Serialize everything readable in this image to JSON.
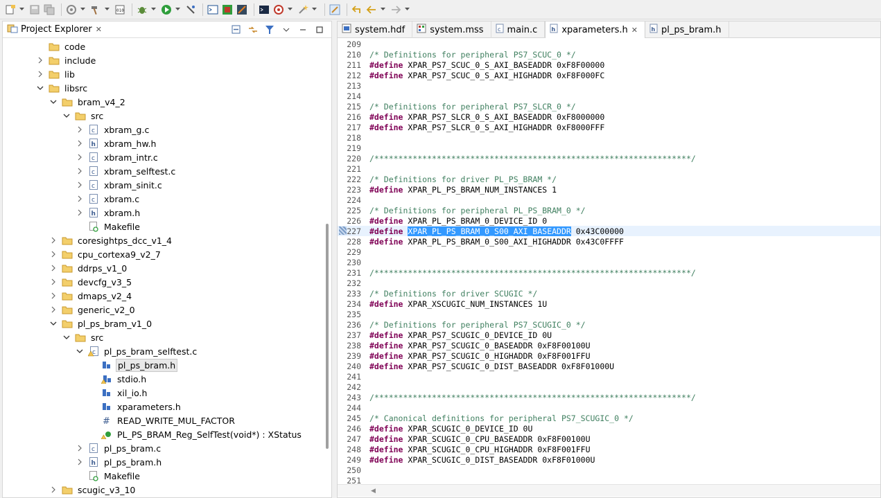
{
  "toolbar": {
    "icons": [
      "new-icon",
      "save-icon",
      "save-all-icon",
      "build-config-icon",
      "hammer-icon",
      "binary-icon",
      "debug-icon",
      "run-icon",
      "program-fpga-icon",
      "terminal-icon",
      "xsct-icon",
      "jtag-icon",
      "console-icon",
      "target-icon",
      "wand-icon",
      "edit-icon",
      "back-edit-icon",
      "back-icon",
      "forward-icon"
    ]
  },
  "explorer": {
    "title": "Project Explorer",
    "close": "✕",
    "tree": [
      {
        "label": "code",
        "indent": 0,
        "twisty": "none",
        "icon": "folder"
      },
      {
        "label": "include",
        "indent": 0,
        "twisty": "closed",
        "icon": "folder"
      },
      {
        "label": "lib",
        "indent": 0,
        "twisty": "closed",
        "icon": "folder"
      },
      {
        "label": "libsrc",
        "indent": 0,
        "twisty": "open",
        "icon": "folder"
      },
      {
        "label": "bram_v4_2",
        "indent": 1,
        "twisty": "open",
        "icon": "folder"
      },
      {
        "label": "src",
        "indent": 2,
        "twisty": "open",
        "icon": "folder"
      },
      {
        "label": "xbram_g.c",
        "indent": 3,
        "twisty": "closed",
        "icon": "c"
      },
      {
        "label": "xbram_hw.h",
        "indent": 3,
        "twisty": "closed",
        "icon": "h"
      },
      {
        "label": "xbram_intr.c",
        "indent": 3,
        "twisty": "closed",
        "icon": "c"
      },
      {
        "label": "xbram_selftest.c",
        "indent": 3,
        "twisty": "closed",
        "icon": "c"
      },
      {
        "label": "xbram_sinit.c",
        "indent": 3,
        "twisty": "closed",
        "icon": "c"
      },
      {
        "label": "xbram.c",
        "indent": 3,
        "twisty": "closed",
        "icon": "c"
      },
      {
        "label": "xbram.h",
        "indent": 3,
        "twisty": "closed",
        "icon": "h"
      },
      {
        "label": "Makefile",
        "indent": 3,
        "twisty": "none",
        "icon": "make"
      },
      {
        "label": "coresightps_dcc_v1_4",
        "indent": 1,
        "twisty": "closed",
        "icon": "folder"
      },
      {
        "label": "cpu_cortexa9_v2_7",
        "indent": 1,
        "twisty": "closed",
        "icon": "folder"
      },
      {
        "label": "ddrps_v1_0",
        "indent": 1,
        "twisty": "closed",
        "icon": "folder"
      },
      {
        "label": "devcfg_v3_5",
        "indent": 1,
        "twisty": "closed",
        "icon": "folder"
      },
      {
        "label": "dmaps_v2_4",
        "indent": 1,
        "twisty": "closed",
        "icon": "folder"
      },
      {
        "label": "generic_v2_0",
        "indent": 1,
        "twisty": "closed",
        "icon": "folder"
      },
      {
        "label": "pl_ps_bram_v1_0",
        "indent": 1,
        "twisty": "open",
        "icon": "folder"
      },
      {
        "label": "src",
        "indent": 2,
        "twisty": "open",
        "icon": "folder"
      },
      {
        "label": "pl_ps_bram_selftest.c",
        "indent": 3,
        "twisty": "open",
        "icon": "c-warn"
      },
      {
        "label": "pl_ps_bram.h",
        "indent": 4,
        "twisty": "none",
        "icon": "include",
        "selected": true
      },
      {
        "label": "stdio.h",
        "indent": 4,
        "twisty": "none",
        "icon": "include-warn"
      },
      {
        "label": "xil_io.h",
        "indent": 4,
        "twisty": "none",
        "icon": "include"
      },
      {
        "label": "xparameters.h",
        "indent": 4,
        "twisty": "none",
        "icon": "include"
      },
      {
        "label": "READ_WRITE_MUL_FACTOR",
        "indent": 4,
        "twisty": "none",
        "icon": "macro"
      },
      {
        "label": "PL_PS_BRAM_Reg_SelfTest(void*) : XStatus",
        "indent": 4,
        "twisty": "none",
        "icon": "function"
      },
      {
        "label": "pl_ps_bram.c",
        "indent": 3,
        "twisty": "closed",
        "icon": "c"
      },
      {
        "label": "pl_ps_bram.h",
        "indent": 3,
        "twisty": "closed",
        "icon": "h"
      },
      {
        "label": "Makefile",
        "indent": 3,
        "twisty": "none",
        "icon": "make"
      },
      {
        "label": "scugic_v3_10",
        "indent": 1,
        "twisty": "closed",
        "icon": "folder"
      }
    ]
  },
  "editor": {
    "tabs": [
      {
        "label": "system.hdf",
        "icon": "hdf",
        "active": false
      },
      {
        "label": "system.mss",
        "icon": "mss",
        "active": false
      },
      {
        "label": "main.c",
        "icon": "c",
        "active": false
      },
      {
        "label": "xparameters.h",
        "icon": "h",
        "active": true,
        "close": "✕"
      },
      {
        "label": "pl_ps_bram.h",
        "icon": "h",
        "active": false
      }
    ],
    "lines": [
      {
        "n": "209",
        "type": "blank",
        "text": ""
      },
      {
        "n": "210",
        "type": "comment",
        "text": "/* Definitions for peripheral PS7_SCUC_0 */"
      },
      {
        "n": "211",
        "type": "define",
        "kw": "#define",
        "text": " XPAR_PS7_SCUC_0_S_AXI_BASEADDR 0xF8F00000"
      },
      {
        "n": "212",
        "type": "define",
        "kw": "#define",
        "text": " XPAR_PS7_SCUC_0_S_AXI_HIGHADDR 0xF8F000FC"
      },
      {
        "n": "213",
        "type": "blank",
        "text": ""
      },
      {
        "n": "214",
        "type": "blank",
        "text": ""
      },
      {
        "n": "215",
        "type": "comment",
        "text": "/* Definitions for peripheral PS7_SLCR_0 */"
      },
      {
        "n": "216",
        "type": "define",
        "kw": "#define",
        "text": " XPAR_PS7_SLCR_0_S_AXI_BASEADDR 0xF8000000"
      },
      {
        "n": "217",
        "type": "define",
        "kw": "#define",
        "text": " XPAR_PS7_SLCR_0_S_AXI_HIGHADDR 0xF8000FFF"
      },
      {
        "n": "218",
        "type": "blank",
        "text": ""
      },
      {
        "n": "219",
        "type": "blank",
        "text": ""
      },
      {
        "n": "220",
        "type": "comment",
        "text": "/******************************************************************/"
      },
      {
        "n": "221",
        "type": "blank",
        "text": ""
      },
      {
        "n": "222",
        "type": "comment",
        "text": "/* Definitions for driver PL_PS_BRAM */"
      },
      {
        "n": "223",
        "type": "define",
        "kw": "#define",
        "text": " XPAR_PL_PS_BRAM_NUM_INSTANCES 1"
      },
      {
        "n": "224",
        "type": "blank",
        "text": ""
      },
      {
        "n": "225",
        "type": "comment",
        "text": "/* Definitions for peripheral PL_PS_BRAM_0 */"
      },
      {
        "n": "226",
        "type": "define",
        "kw": "#define",
        "text": " XPAR_PL_PS_BRAM_0_DEVICE_ID 0"
      },
      {
        "n": "227",
        "type": "define-hl",
        "kw": "#define",
        "hl": "XPAR_PL_PS_BRAM_0_S00_AXI_BASEADDR",
        "text": " 0x43C00000",
        "current": true
      },
      {
        "n": "228",
        "type": "define",
        "kw": "#define",
        "text": " XPAR_PL_PS_BRAM_0_S00_AXI_HIGHADDR 0x43C0FFFF"
      },
      {
        "n": "229",
        "type": "blank",
        "text": ""
      },
      {
        "n": "230",
        "type": "blank",
        "text": ""
      },
      {
        "n": "231",
        "type": "comment",
        "text": "/******************************************************************/"
      },
      {
        "n": "232",
        "type": "blank",
        "text": ""
      },
      {
        "n": "233",
        "type": "comment",
        "text": "/* Definitions for driver SCUGIC */"
      },
      {
        "n": "234",
        "type": "define",
        "kw": "#define",
        "text": " XPAR_XSCUGIC_NUM_INSTANCES 1U"
      },
      {
        "n": "235",
        "type": "blank",
        "text": ""
      },
      {
        "n": "236",
        "type": "comment",
        "text": "/* Definitions for peripheral PS7_SCUGIC_0 */"
      },
      {
        "n": "237",
        "type": "define",
        "kw": "#define",
        "text": " XPAR_PS7_SCUGIC_0_DEVICE_ID 0U"
      },
      {
        "n": "238",
        "type": "define",
        "kw": "#define",
        "text": " XPAR_PS7_SCUGIC_0_BASEADDR 0xF8F00100U"
      },
      {
        "n": "239",
        "type": "define",
        "kw": "#define",
        "text": " XPAR_PS7_SCUGIC_0_HIGHADDR 0xF8F001FFU"
      },
      {
        "n": "240",
        "type": "define",
        "kw": "#define",
        "text": " XPAR_PS7_SCUGIC_0_DIST_BASEADDR 0xF8F01000U"
      },
      {
        "n": "241",
        "type": "blank",
        "text": ""
      },
      {
        "n": "242",
        "type": "blank",
        "text": ""
      },
      {
        "n": "243",
        "type": "comment",
        "text": "/******************************************************************/"
      },
      {
        "n": "244",
        "type": "blank",
        "text": ""
      },
      {
        "n": "245",
        "type": "comment",
        "text": "/* Canonical definitions for peripheral PS7_SCUGIC_0 */"
      },
      {
        "n": "246",
        "type": "define",
        "kw": "#define",
        "text": " XPAR_SCUGIC_0_DEVICE_ID 0U"
      },
      {
        "n": "247",
        "type": "define",
        "kw": "#define",
        "text": " XPAR_SCUGIC_0_CPU_BASEADDR 0xF8F00100U"
      },
      {
        "n": "248",
        "type": "define",
        "kw": "#define",
        "text": " XPAR_SCUGIC_0_CPU_HIGHADDR 0xF8F001FFU"
      },
      {
        "n": "249",
        "type": "define",
        "kw": "#define",
        "text": " XPAR_SCUGIC_0_DIST_BASEADDR 0xF8F01000U"
      },
      {
        "n": "250",
        "type": "blank",
        "text": ""
      },
      {
        "n": "251",
        "type": "blank",
        "text": ""
      }
    ]
  },
  "colors": {
    "comment": "#3f7f5f",
    "keyword": "#7f0055",
    "selection": "#3399ff",
    "current_line": "#e8f2fe",
    "folder": "#e8b84a"
  }
}
